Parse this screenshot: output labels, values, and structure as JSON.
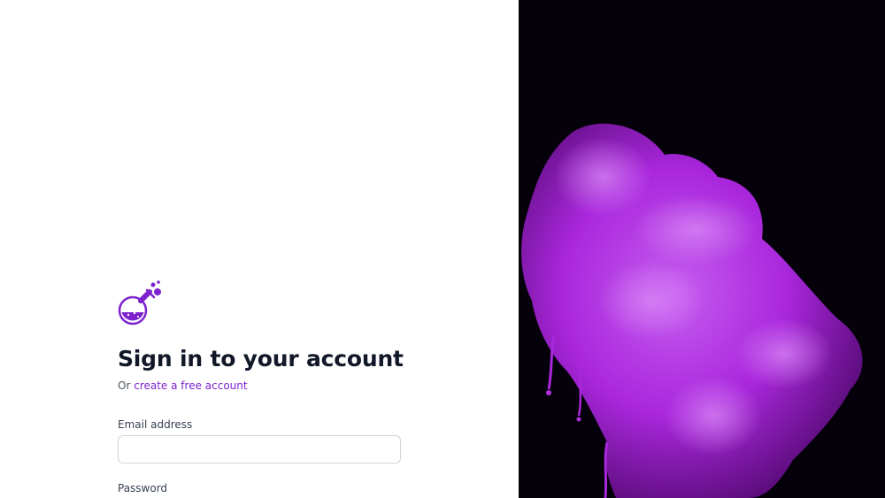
{
  "brand": {
    "logo_icon": "flask-icon",
    "accent_color": "#7e22ce"
  },
  "signin": {
    "title": "Sign in to your account",
    "subtitle_prefix": "Or",
    "create_account_link": "create a free account"
  },
  "form": {
    "email_label": "Email address",
    "email_value": "",
    "password_label": "Password"
  },
  "hero": {
    "image_description_icon": "purple-ink-smoke-image",
    "background_color": "#05010a",
    "ink_color": "#b12ee6"
  }
}
